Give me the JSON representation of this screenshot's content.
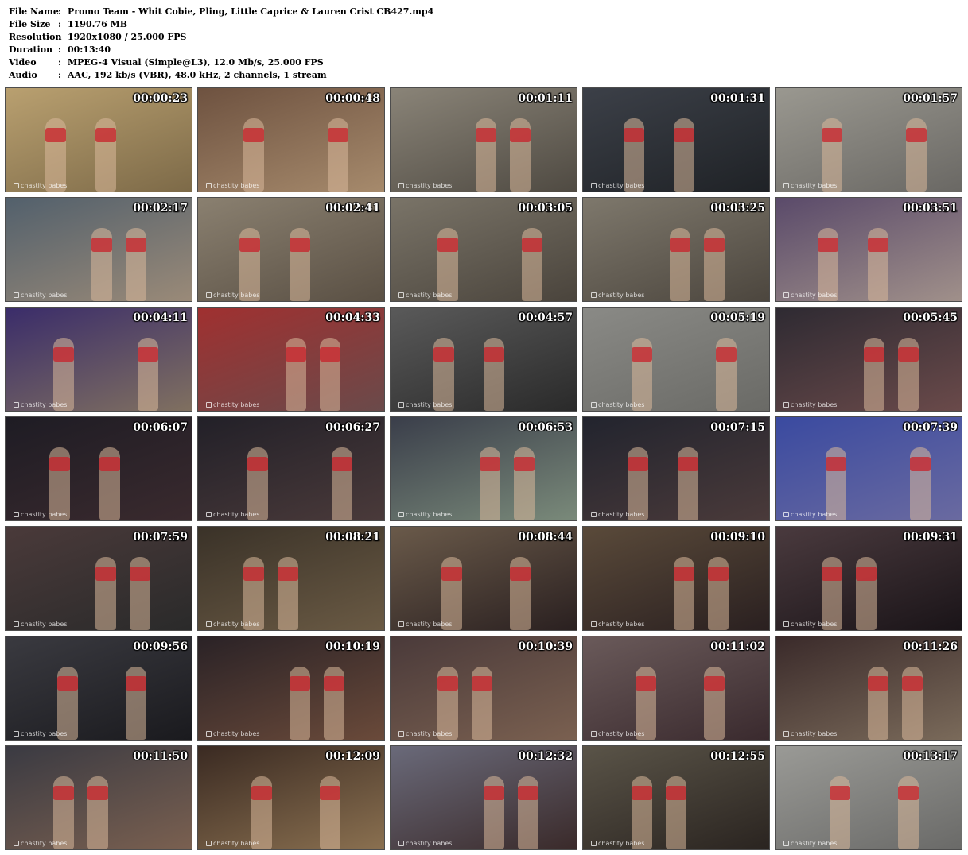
{
  "info": [
    {
      "label": "File Name",
      "sep": ":",
      "value": "Promo Team - Whit Cobie, Pling, Little Caprice & Lauren Crist CB427.mp4"
    },
    {
      "label": "File Size",
      "sep": ":",
      "value": "1190.76 MB"
    },
    {
      "label": "Resolution",
      "sep": ":",
      "value": "1920x1080 / 25.000 FPS"
    },
    {
      "label": "Duration",
      "sep": ":",
      "value": "00:13:40"
    },
    {
      "label": "Video",
      "sep": ":",
      "value": "MPEG-4 Visual (Simple@L3), 12.0 Mb/s, 25.000 FPS"
    },
    {
      "label": "Audio",
      "sep": ":",
      "value": "AAC, 192 kb/s (VBR), 48.0 kHz, 2 channels, 1 stream"
    }
  ],
  "watermark": "chastity babes",
  "thumbnails": [
    {
      "time": "00:00:23",
      "colors": [
        "#b9a070",
        "#7d6a48"
      ]
    },
    {
      "time": "00:00:48",
      "colors": [
        "#6e5240",
        "#a68a6c"
      ]
    },
    {
      "time": "00:01:11",
      "colors": [
        "#8a8478",
        "#4f4a42"
      ]
    },
    {
      "time": "00:01:31",
      "colors": [
        "#3c4048",
        "#1f2226"
      ]
    },
    {
      "time": "00:01:57",
      "colors": [
        "#9a9890",
        "#6a6864"
      ]
    },
    {
      "time": "00:02:17",
      "colors": [
        "#52606c",
        "#9a8a78"
      ]
    },
    {
      "time": "00:02:41",
      "colors": [
        "#8a8070",
        "#5a5044"
      ]
    },
    {
      "time": "00:03:05",
      "colors": [
        "#7a7468",
        "#4a443c"
      ]
    },
    {
      "time": "00:03:25",
      "colors": [
        "#7e786c",
        "#4c463e"
      ]
    },
    {
      "time": "00:03:51",
      "colors": [
        "#5a4a6a",
        "#a0908a"
      ]
    },
    {
      "time": "00:04:11",
      "colors": [
        "#3a2c6a",
        "#807060"
      ]
    },
    {
      "time": "00:04:33",
      "colors": [
        "#a03030",
        "#6a4a4a"
      ]
    },
    {
      "time": "00:04:57",
      "colors": [
        "#5a5a5a",
        "#2a2a2a"
      ]
    },
    {
      "time": "00:05:19",
      "colors": [
        "#8a8a86",
        "#6a6a66"
      ]
    },
    {
      "time": "00:05:45",
      "colors": [
        "#2e2a32",
        "#6a4a4a"
      ]
    },
    {
      "time": "00:06:07",
      "colors": [
        "#1e1c24",
        "#3a2a2e"
      ]
    },
    {
      "time": "00:06:27",
      "colors": [
        "#222028",
        "#4a3a3a"
      ]
    },
    {
      "time": "00:06:53",
      "colors": [
        "#3a3e4a",
        "#7a8a7a"
      ]
    },
    {
      "time": "00:07:15",
      "colors": [
        "#22242e",
        "#4a3a3a"
      ]
    },
    {
      "time": "00:07:39",
      "colors": [
        "#3a4aa0",
        "#6a6aa0"
      ]
    },
    {
      "time": "00:07:59",
      "colors": [
        "#4a3a3a",
        "#2a2a2a"
      ]
    },
    {
      "time": "00:08:21",
      "colors": [
        "#3a3228",
        "#6a5a44"
      ]
    },
    {
      "time": "00:08:44",
      "colors": [
        "#6a5a4a",
        "#2a2020"
      ]
    },
    {
      "time": "00:09:10",
      "colors": [
        "#5a4a3a",
        "#2a2020"
      ]
    },
    {
      "time": "00:09:31",
      "colors": [
        "#4a3a3e",
        "#1a1418"
      ]
    },
    {
      "time": "00:09:56",
      "colors": [
        "#3a3a40",
        "#1a1a1e"
      ]
    },
    {
      "time": "00:10:19",
      "colors": [
        "#2a2226",
        "#6a4a3a"
      ]
    },
    {
      "time": "00:10:39",
      "colors": [
        "#4a3a3a",
        "#7a6050"
      ]
    },
    {
      "time": "00:11:02",
      "colors": [
        "#6a5a5a",
        "#3a2a2e"
      ]
    },
    {
      "time": "00:11:26",
      "colors": [
        "#3a2a2a",
        "#7a6a5a"
      ]
    },
    {
      "time": "00:11:50",
      "colors": [
        "#3a3a42",
        "#7a6050"
      ]
    },
    {
      "time": "00:12:09",
      "colors": [
        "#3a2a22",
        "#8a7050"
      ]
    },
    {
      "time": "00:12:32",
      "colors": [
        "#6a6a7a",
        "#3a2a2a"
      ]
    },
    {
      "time": "00:12:55",
      "colors": [
        "#5a5448",
        "#2a2420"
      ]
    },
    {
      "time": "00:13:17",
      "colors": [
        "#9a9a96",
        "#6a6a68"
      ]
    }
  ]
}
